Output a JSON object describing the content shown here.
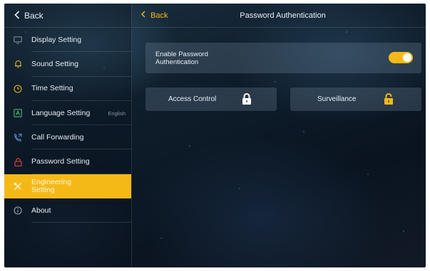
{
  "sidebar": {
    "back_label": "Back",
    "items": [
      {
        "label": "Display Setting",
        "icon": "monitor-icon",
        "sub": ""
      },
      {
        "label": "Sound Setting",
        "icon": "bell-icon",
        "sub": ""
      },
      {
        "label": "Time Setting",
        "icon": "clock-icon",
        "sub": ""
      },
      {
        "label": "Language Setting",
        "icon": "language-icon",
        "sub": "English"
      },
      {
        "label": "Call Forwarding",
        "icon": "call-forward-icon",
        "sub": ""
      },
      {
        "label": "Password Setting",
        "icon": "lock-icon",
        "sub": ""
      },
      {
        "label": "Engineering Setting",
        "icon": "tools-icon",
        "sub": ""
      },
      {
        "label": "About",
        "icon": "info-icon",
        "sub": ""
      }
    ],
    "active_index": 6
  },
  "header": {
    "back_label": "Back",
    "title": "Password Authentication"
  },
  "toggle_row": {
    "label": "Enable Password Authentication",
    "enabled": true
  },
  "cards": [
    {
      "label": "Access Control",
      "icon": "lock-closed-icon"
    },
    {
      "label": "Surveillance",
      "icon": "lock-open-icon"
    }
  ],
  "colors": {
    "accent": "#f5b917",
    "icon_gray": "#7e8b96",
    "icon_red": "#e0483a"
  }
}
